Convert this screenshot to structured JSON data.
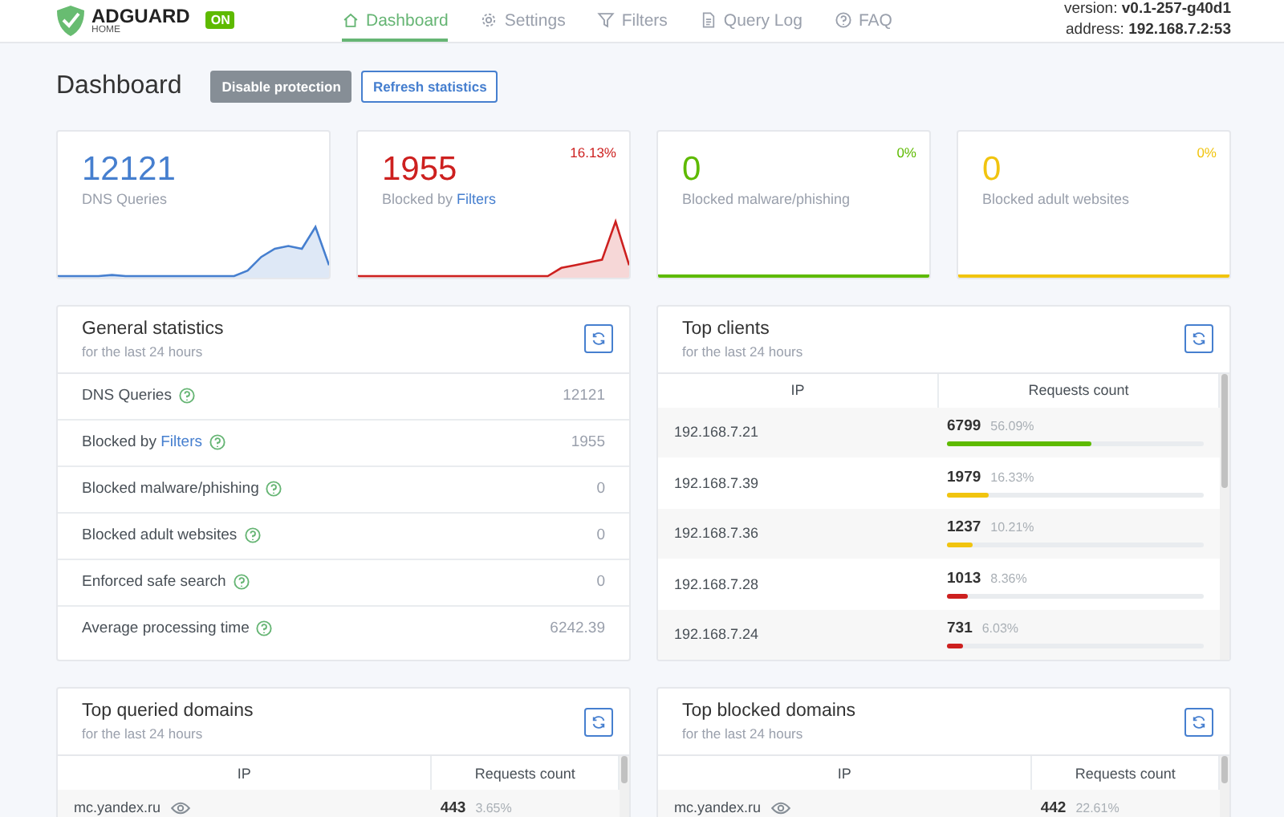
{
  "header": {
    "logo": {
      "name": "ADGUARD",
      "sub": "HOME"
    },
    "status_badge": "ON",
    "nav": [
      {
        "label": "Dashboard",
        "selected": true
      },
      {
        "label": "Settings",
        "selected": false
      },
      {
        "label": "Filters",
        "selected": false
      },
      {
        "label": "Query Log",
        "selected": false
      },
      {
        "label": "FAQ",
        "selected": false
      }
    ],
    "version_label": "version:",
    "version": "v0.1-257-g40d1",
    "address_label": "address:",
    "address": "192.168.7.2:53"
  },
  "page_title": "Dashboard",
  "buttons": [
    {
      "label": "Disable protection",
      "kind": "dark"
    },
    {
      "label": "Refresh statistics",
      "kind": "outline"
    }
  ],
  "stat_cards": [
    {
      "value": "12121",
      "label": "DNS Queries",
      "color": "#467fcf"
    },
    {
      "value": "1955",
      "label": "Blocked by ",
      "link": "Filters",
      "percent": "16.13%",
      "color": "#cd201f"
    },
    {
      "value": "0",
      "label": "Blocked malware/phishing",
      "percent": "0%",
      "color": "#5eba00"
    },
    {
      "value": "0",
      "label": "Blocked adult websites",
      "percent": "0%",
      "color": "#f1c40f"
    }
  ],
  "general_statistics": {
    "title": "General statistics",
    "subtitle": "for the last 24 hours",
    "rows": [
      {
        "label": "DNS Queries",
        "value": "12121"
      },
      {
        "label": "Blocked by ",
        "link": "Filters",
        "value": "1955"
      },
      {
        "label": "Blocked malware/phishing",
        "value": "0"
      },
      {
        "label": "Blocked adult websites",
        "value": "0"
      },
      {
        "label": "Enforced safe search",
        "value": "0"
      },
      {
        "label": "Average processing time",
        "value": "6242.39"
      }
    ]
  },
  "top_clients": {
    "title": "Top clients",
    "subtitle": "for the last 24 hours",
    "columns": [
      "IP",
      "Requests count"
    ],
    "rows": [
      {
        "ip": "192.168.7.21",
        "count": "6799",
        "percent": "56.09%",
        "level": 0.5609,
        "color": "#5eba00"
      },
      {
        "ip": "192.168.7.39",
        "count": "1979",
        "percent": "16.33%",
        "level": 0.1633,
        "color": "#f1c40f"
      },
      {
        "ip": "192.168.7.36",
        "count": "1237",
        "percent": "10.21%",
        "level": 0.1021,
        "color": "#f1c40f"
      },
      {
        "ip": "192.168.7.28",
        "count": "1013",
        "percent": "8.36%",
        "level": 0.0836,
        "color": "#cd201f"
      },
      {
        "ip": "192.168.7.24",
        "count": "731",
        "percent": "6.03%",
        "level": 0.0603,
        "color": "#cd201f"
      }
    ]
  },
  "top_queried_domains": {
    "title": "Top queried domains",
    "subtitle": "for the last 24 hours",
    "columns": [
      "IP",
      "Requests count"
    ],
    "rows": [
      {
        "domain": "mc.yandex.ru",
        "count": "443",
        "percent": "3.65%"
      }
    ]
  },
  "top_blocked_domains": {
    "title": "Top blocked domains",
    "subtitle": "for the last 24 hours",
    "columns": [
      "IP",
      "Requests count"
    ],
    "rows": [
      {
        "domain": "mc.yandex.ru",
        "count": "442",
        "percent": "22.61%"
      }
    ]
  }
}
